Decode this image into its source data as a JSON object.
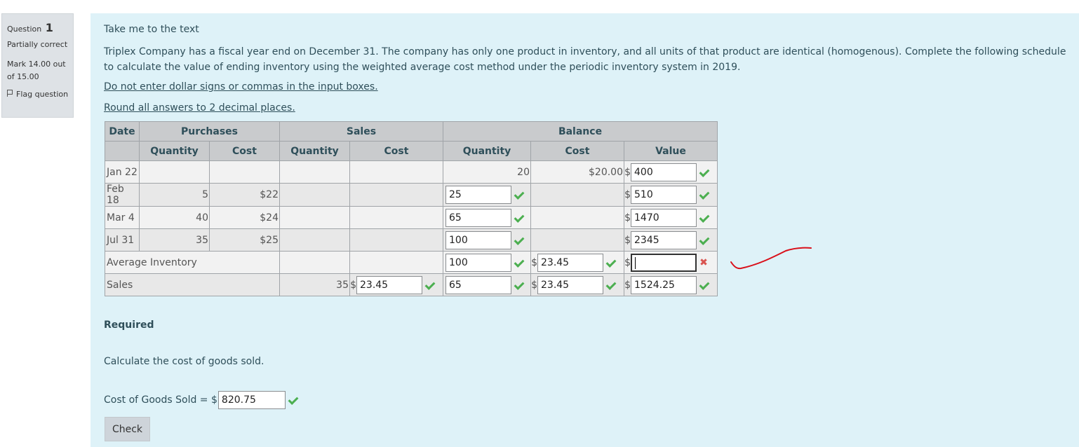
{
  "question_info": {
    "question_label": "Question",
    "question_number": "1",
    "state": "Partially correct",
    "grade": "Mark 14.00 out of 15.00",
    "flag_label": "Flag question"
  },
  "content": {
    "link_text": "Take me to the text",
    "intro": "Triplex Company has a fiscal year end on December 31. The company has only one product in inventory, and all units of that product are identical (homogenous). Complete the following schedule to calculate the value of ending inventory using the weighted average cost method under the periodic inventory system in 2019.",
    "instruction1": "Do not enter dollar signs or commas in the input boxes.",
    "instruction2": "Round all answers to 2 decimal places.",
    "required_heading": "Required",
    "required_text": "Calculate the cost of goods sold.",
    "cogs_label": "Cost of Goods Sold = ",
    "cogs_value": "820.75",
    "check_button": "Check"
  },
  "table": {
    "headers": {
      "date": "Date",
      "purchases": "Purchases",
      "sales": "Sales",
      "balance": "Balance",
      "quantity": "Quantity",
      "cost": "Cost",
      "value": "Value"
    },
    "rows": {
      "jan22": {
        "date": "Jan 22",
        "bal_qty": "20",
        "bal_cost": "$20.00",
        "bal_value": "400"
      },
      "feb18": {
        "date": "Feb 18",
        "pur_qty": "5",
        "pur_cost": "$22",
        "bal_qty": "25",
        "bal_value": "510"
      },
      "mar4": {
        "date": "Mar 4",
        "pur_qty": "40",
        "pur_cost": "$24",
        "bal_qty": "65",
        "bal_value": "1470"
      },
      "jul31": {
        "date": "Jul 31",
        "pur_qty": "35",
        "pur_cost": "$25",
        "bal_qty": "100",
        "bal_value": "2345"
      },
      "avg": {
        "label": "Average Inventory",
        "bal_qty": "100",
        "bal_cost": "23.45",
        "bal_value": ""
      },
      "sales": {
        "label": "Sales",
        "sales_qty": "35",
        "sales_cost": "23.45",
        "bal_qty": "65",
        "bal_cost": "23.45",
        "bal_value": "1524.25"
      }
    },
    "currency_symbol": "$",
    "check_color": "#4caf50",
    "cross_color": "#d9534f"
  },
  "annotation": {
    "pen_color": "#d9101a"
  }
}
